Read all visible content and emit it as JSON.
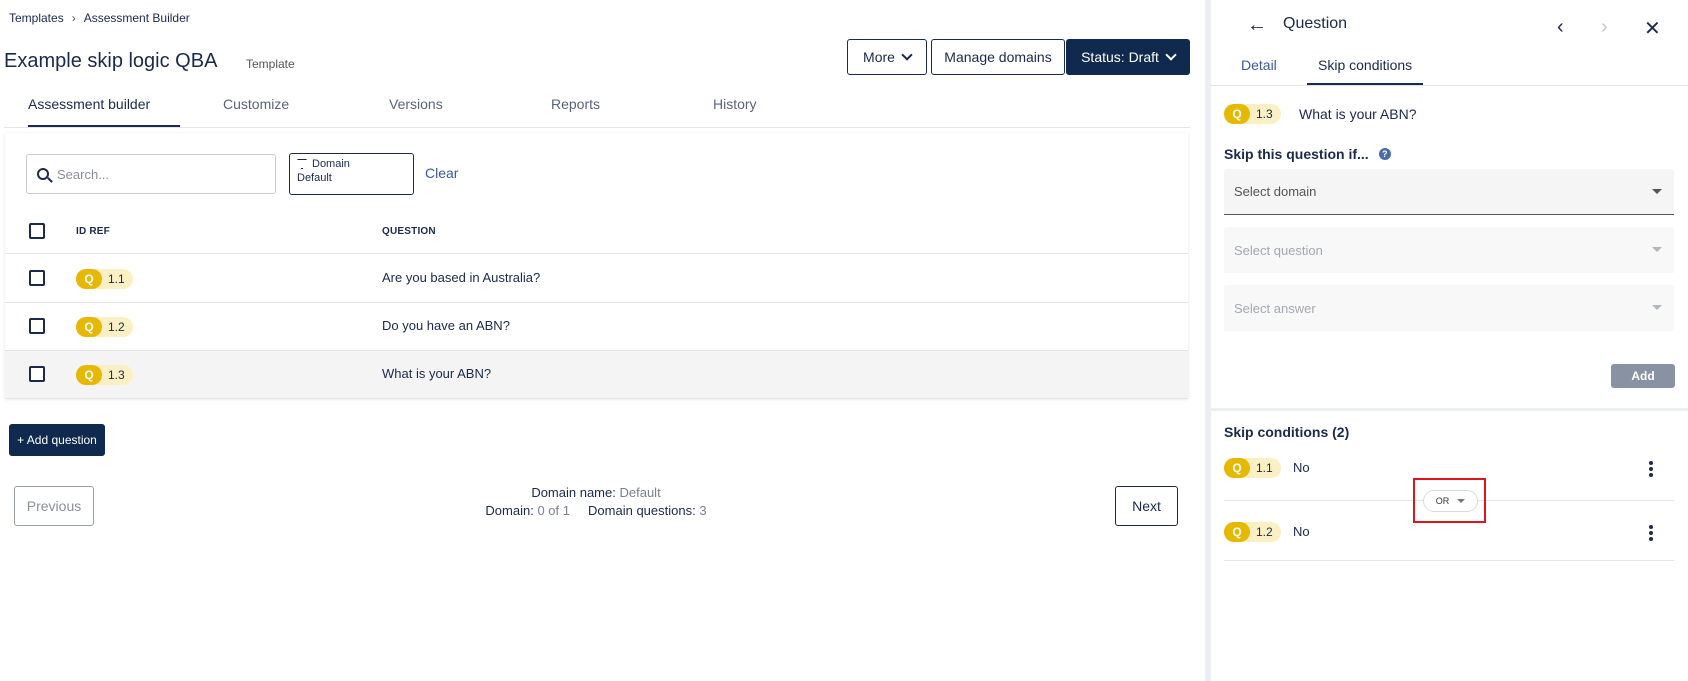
{
  "breadcrumb": {
    "root": "Templates",
    "current": "Assessment Builder"
  },
  "header": {
    "title": "Example skip logic QBA",
    "tag": "Template",
    "more_label": "More",
    "manage_domains_label": "Manage domains",
    "status_label": "Status: Draft"
  },
  "tabs": [
    "Assessment builder",
    "Customize",
    "Versions",
    "Reports",
    "History"
  ],
  "filters": {
    "search_placeholder": "Search...",
    "domain_label": "Domain",
    "domain_value": "Default",
    "clear_label": "Clear"
  },
  "table": {
    "columns": [
      "ID REF",
      "QUESTION"
    ],
    "rows": [
      {
        "badge": "Q",
        "id": "1.1",
        "question": "Are you based in Australia?"
      },
      {
        "badge": "Q",
        "id": "1.2",
        "question": "Do you have an ABN?"
      },
      {
        "badge": "Q",
        "id": "1.3",
        "question": "What is your ABN?"
      }
    ]
  },
  "actions": {
    "add_question": "+ Add question"
  },
  "pagination": {
    "previous": "Previous",
    "next": "Next",
    "domain_name_label": "Domain name:",
    "domain_name_value": "Default",
    "domain_label": "Domain:",
    "domain_value": "0 of 1",
    "domain_questions_label": "Domain questions:",
    "domain_questions_value": "3"
  },
  "panel": {
    "title": "Question",
    "tabs": [
      "Detail",
      "Skip conditions"
    ],
    "question": {
      "badge": "Q",
      "id": "1.3",
      "text": "What is your ABN?"
    },
    "skip_if_label": "Skip this question if...",
    "select_domain": "Select domain",
    "select_question": "Select question",
    "select_answer": "Select answer",
    "add_label": "Add",
    "conditions_title": "Skip conditions (2)",
    "conditions": [
      {
        "badge": "Q",
        "id": "1.1",
        "answer": "No"
      },
      {
        "badge": "Q",
        "id": "1.2",
        "answer": "No"
      }
    ],
    "operator": "OR"
  },
  "colors": {
    "navy": "#0f2a4e",
    "badge_yellow": "#e6b800",
    "badge_bg": "#fbf0c3",
    "highlight_red": "#e0141e"
  }
}
